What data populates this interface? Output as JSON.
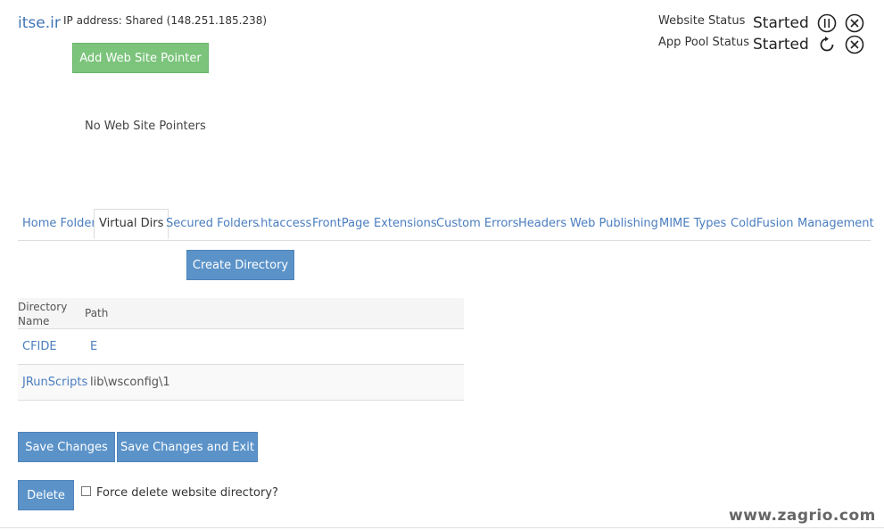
{
  "header": {
    "site_name": "itse.ir",
    "ip_label": "IP address: Shared (148.251.185.238)",
    "add_pointer_label": "Add Web Site Pointer",
    "no_pointers_text": "No Web Site Pointers"
  },
  "status": {
    "website_label": "Website Status",
    "website_value": "Started",
    "app_pool_label": "App Pool Status",
    "app_pool_value": "Started",
    "icons": [
      "pause-icon",
      "stop-icon",
      "restart-icon",
      "stop-icon"
    ]
  },
  "tabs": [
    {
      "label": "Home Folder"
    },
    {
      "label": "Virtual Dirs",
      "active": true
    },
    {
      "label": "Secured Folders"
    },
    {
      "label": ".htaccess"
    },
    {
      "label": "FrontPage"
    },
    {
      "label": "Extensions"
    },
    {
      "label": "Custom Errors"
    },
    {
      "label": "Headers"
    },
    {
      "label": "Web Publishing"
    },
    {
      "label": "MIME Types"
    },
    {
      "label": "ColdFusion"
    },
    {
      "label": "Management"
    }
  ],
  "virtual_dirs": {
    "create_label": "Create Directory",
    "columns": [
      "Directory Name",
      "Path"
    ],
    "col_directory_line1": "Directory",
    "col_directory_line2": "Name",
    "col_path": "Path",
    "rows": [
      {
        "name": "CFIDE",
        "path": "E"
      },
      {
        "name": "JRunScripts",
        "path": "lib\\wsconfig\\1"
      }
    ]
  },
  "actions": {
    "save_label": "Save Changes",
    "save_exit_label": "Save Changes and Exit",
    "delete_label": "Delete",
    "force_delete_label": "Force delete website directory?",
    "force_delete_checked": false
  },
  "watermark": "www.zagrio.com",
  "colors": {
    "link": "#4a7dbf",
    "green_button": "#7cc47c",
    "blue_button": "#5b93c9"
  }
}
